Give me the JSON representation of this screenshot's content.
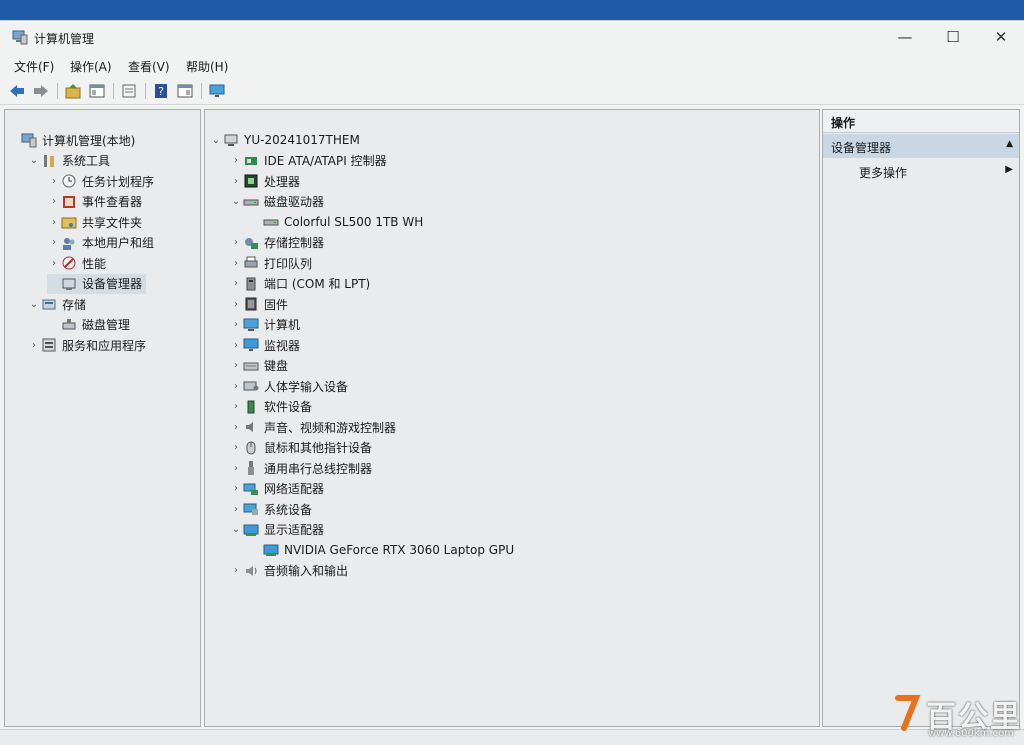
{
  "window": {
    "title": "计算机管理",
    "controls": {
      "minimize": "—",
      "maximize": "☐",
      "close": "✕"
    }
  },
  "menu": [
    "文件(F)",
    "操作(A)",
    "查看(V)",
    "帮助(H)"
  ],
  "toolbar_icons": [
    "back-arrow-icon",
    "forward-arrow-icon",
    "up-folder-icon",
    "show-hide-tree-icon",
    "properties-icon",
    "help-icon",
    "show-hide-action-pane-icon",
    "monitor-icon"
  ],
  "left_tree": [
    {
      "label": "计算机管理(本地)",
      "icon": "computer-management-icon",
      "level": 0,
      "chevron": "",
      "selected": false
    },
    {
      "label": "系统工具",
      "icon": "system-tools-icon",
      "level": 1,
      "chevron": "⌄",
      "selected": false
    },
    {
      "label": "任务计划程序",
      "icon": "task-scheduler-icon",
      "level": 2,
      "chevron": "›",
      "selected": false
    },
    {
      "label": "事件查看器",
      "icon": "event-viewer-icon",
      "level": 2,
      "chevron": "›",
      "selected": false
    },
    {
      "label": "共享文件夹",
      "icon": "shared-folder-icon",
      "level": 2,
      "chevron": "›",
      "selected": false
    },
    {
      "label": "本地用户和组",
      "icon": "local-users-icon",
      "level": 2,
      "chevron": "›",
      "selected": false
    },
    {
      "label": "性能",
      "icon": "performance-icon",
      "level": 2,
      "chevron": "›",
      "selected": false
    },
    {
      "label": "设备管理器",
      "icon": "device-manager-icon",
      "level": 2,
      "chevron": "",
      "selected": true
    },
    {
      "label": "存储",
      "icon": "storage-icon",
      "level": 1,
      "chevron": "⌄",
      "selected": false
    },
    {
      "label": "磁盘管理",
      "icon": "disk-management-icon",
      "level": 2,
      "chevron": "",
      "selected": false
    },
    {
      "label": "服务和应用程序",
      "icon": "services-apps-icon",
      "level": 1,
      "chevron": "›",
      "selected": false
    }
  ],
  "device_tree": [
    {
      "label": "YU-20241017THEM",
      "icon": "computer-root-icon",
      "level": 0,
      "chevron": "⌄"
    },
    {
      "label": "IDE ATA/ATAPI 控制器",
      "icon": "ide-controller-icon",
      "level": 1,
      "chevron": "›"
    },
    {
      "label": "处理器",
      "icon": "processor-icon",
      "level": 1,
      "chevron": "›"
    },
    {
      "label": "磁盘驱动器",
      "icon": "disk-drive-icon",
      "level": 1,
      "chevron": "⌄",
      "selected": true
    },
    {
      "label": "Colorful SL500 1TB WH",
      "icon": "disk-drive-icon",
      "level": 2,
      "chevron": ""
    },
    {
      "label": "存储控制器",
      "icon": "storage-controller-icon",
      "level": 1,
      "chevron": "›"
    },
    {
      "label": "打印队列",
      "icon": "printer-icon",
      "level": 1,
      "chevron": "›"
    },
    {
      "label": "端口 (COM 和 LPT)",
      "icon": "port-icon",
      "level": 1,
      "chevron": "›"
    },
    {
      "label": "固件",
      "icon": "firmware-icon",
      "level": 1,
      "chevron": "›"
    },
    {
      "label": "计算机",
      "icon": "computer-icon",
      "level": 1,
      "chevron": "›"
    },
    {
      "label": "监视器",
      "icon": "monitor-icon",
      "level": 1,
      "chevron": "›"
    },
    {
      "label": "键盘",
      "icon": "keyboard-icon",
      "level": 1,
      "chevron": "›"
    },
    {
      "label": "人体学输入设备",
      "icon": "hid-icon",
      "level": 1,
      "chevron": "›"
    },
    {
      "label": "软件设备",
      "icon": "software-device-icon",
      "level": 1,
      "chevron": "›"
    },
    {
      "label": "声音、视频和游戏控制器",
      "icon": "sound-icon",
      "level": 1,
      "chevron": "›"
    },
    {
      "label": "鼠标和其他指针设备",
      "icon": "mouse-icon",
      "level": 1,
      "chevron": "›"
    },
    {
      "label": "通用串行总线控制器",
      "icon": "usb-icon",
      "level": 1,
      "chevron": "›"
    },
    {
      "label": "网络适配器",
      "icon": "network-adapter-icon",
      "level": 1,
      "chevron": "›"
    },
    {
      "label": "系统设备",
      "icon": "system-device-icon",
      "level": 1,
      "chevron": "›"
    },
    {
      "label": "显示适配器",
      "icon": "display-adapter-icon",
      "level": 1,
      "chevron": "⌄"
    },
    {
      "label": "NVIDIA GeForce RTX 3060 Laptop GPU",
      "icon": "display-adapter-icon",
      "level": 2,
      "chevron": ""
    },
    {
      "label": "音频输入和输出",
      "icon": "audio-io-icon",
      "level": 1,
      "chevron": "›"
    }
  ],
  "actions": {
    "header": "操作",
    "group": "设备管理器",
    "group_caret": "▲",
    "item": "更多操作",
    "item_caret": "▶"
  },
  "watermark": {
    "text": "百公里",
    "url": "www.600km.com"
  },
  "colors": {
    "accent_blue": "#1e5aa8",
    "selection": "#d5dde4",
    "action_group": "#c9d6e3"
  }
}
